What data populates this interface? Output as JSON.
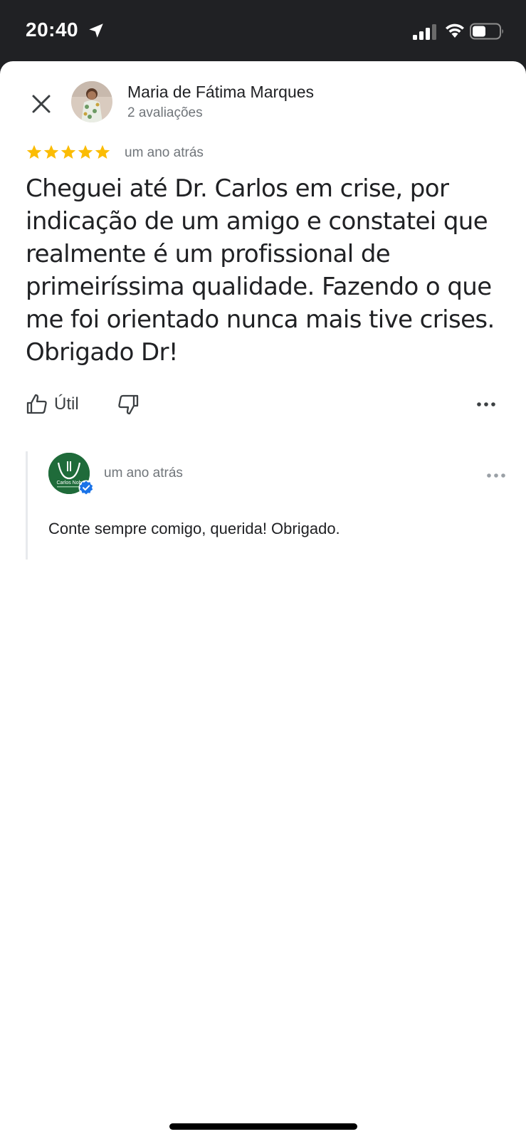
{
  "status_bar": {
    "time": "20:40"
  },
  "reviewer": {
    "name": "Maria de Fátima Marques",
    "review_count": "2 avaliações"
  },
  "review": {
    "rating": 5,
    "max_rating": 5,
    "date": "um ano atrás",
    "text": "Cheguei até Dr. Carlos em crise, por indicação de um amigo e constatei que realmente é um profissional de primeiríssima qualidade. Fazendo o que me foi orientado nunca mais tive crises. Obrigado Dr!"
  },
  "actions": {
    "helpful_label": "Útil"
  },
  "owner_reply": {
    "logo_text": "Carlos Nob",
    "date": "um ano atrás",
    "text": "Conte sempre comigo, querida! Obrigado."
  },
  "colors": {
    "star": "#fbbc04",
    "status_bar_bg": "#202124",
    "verified_badge": "#1a73e8",
    "owner_logo_bg": "#1f6b3a"
  },
  "icons": {
    "close": "close-icon",
    "like": "thumb-up-icon",
    "dislike": "thumb-down-icon",
    "more": "more-horiz-icon",
    "verified": "verified-badge-icon"
  }
}
